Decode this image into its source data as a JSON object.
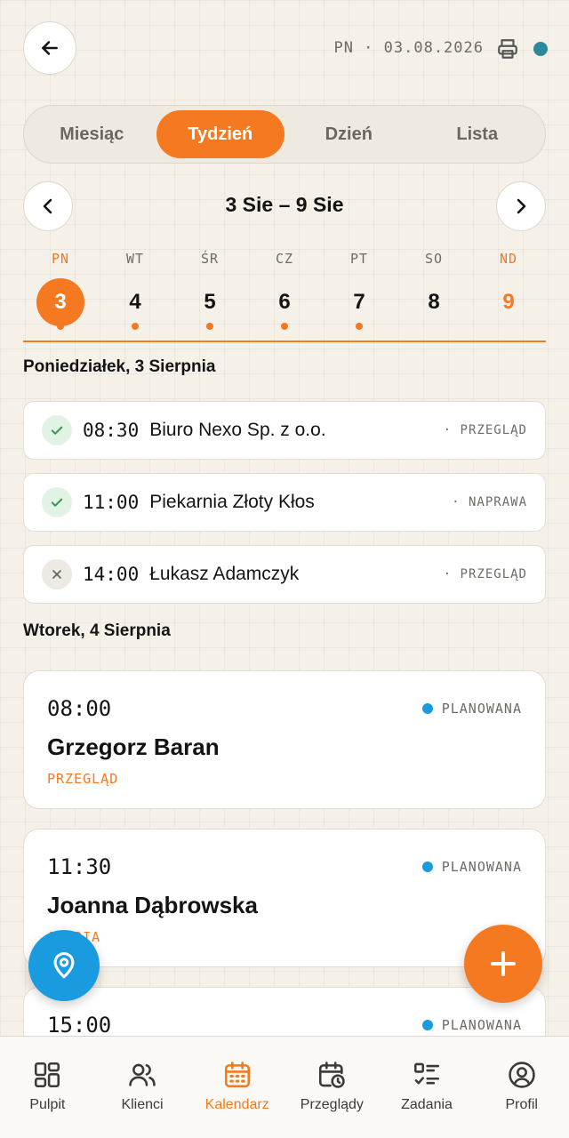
{
  "header": {
    "date": "PN · 03.08.2026"
  },
  "view_tabs": [
    "Miesiąc",
    "Tydzień",
    "Dzień",
    "Lista"
  ],
  "week_range": "3 Sie – 9 Sie",
  "days": [
    {
      "name": "PN",
      "num": "3"
    },
    {
      "name": "WT",
      "num": "4"
    },
    {
      "name": "ŚR",
      "num": "5"
    },
    {
      "name": "CZ",
      "num": "6"
    },
    {
      "name": "PT",
      "num": "7"
    },
    {
      "name": "SO",
      "num": "8"
    },
    {
      "name": "ND",
      "num": "9"
    }
  ],
  "sections": [
    {
      "title": "Poniedziałek, 3 Sierpnia",
      "items": [
        {
          "time": "08:30",
          "name": "Biuro Nexo Sp. z o.o.",
          "type": "· PRZEGLĄD",
          "state": "done"
        },
        {
          "time": "11:00",
          "name": "Piekarnia Złoty Kłos",
          "type": "· NAPRAWA",
          "state": "done"
        },
        {
          "time": "14:00",
          "name": "Łukasz Adamczyk",
          "type": "· PRZEGLĄD",
          "state": "cancelled"
        }
      ]
    },
    {
      "title": "Wtorek, 4 Sierpnia",
      "items": [
        {
          "time": "08:00",
          "name": "Grzegorz Baran",
          "type": "PRZEGLĄD",
          "status": "PLANOWANA"
        },
        {
          "time": "11:30",
          "name": "Joanna Dąbrowska",
          "type": "AWARIA",
          "status": "PLANOWANA"
        },
        {
          "time": "15:00",
          "status": "PLANOWANA"
        }
      ]
    }
  ],
  "bottom_nav": [
    "Pulpit",
    "Klienci",
    "Kalendarz",
    "Przeglądy",
    "Zadania",
    "Profil"
  ],
  "colors": {
    "accent": "#f47920",
    "info": "#1a9be0",
    "background": "#f5f1e9"
  }
}
